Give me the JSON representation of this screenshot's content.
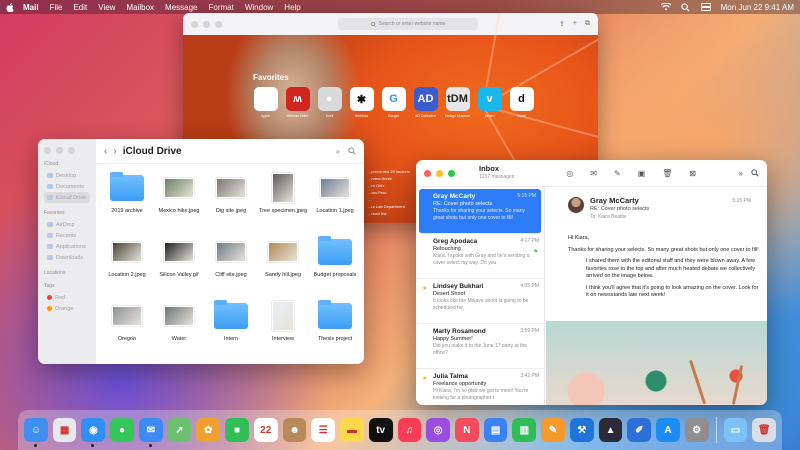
{
  "menubar": {
    "items": [
      "Mail",
      "File",
      "Edit",
      "View",
      "Mailbox",
      "Message",
      "Format",
      "Window",
      "Help"
    ],
    "clock": "Mon Jun 22  9:41 AM"
  },
  "safari": {
    "address_placeholder": "Search or enter website name",
    "favorites_title": "Favorites",
    "favorites": [
      {
        "label": "Apple",
        "glyph": "",
        "bg": "#ffffff",
        "fg": "#111111"
      },
      {
        "label": "Herman Miller",
        "glyph": "ʍ",
        "bg": "#d0261f",
        "fg": "#ffffff"
      },
      {
        "label": "Kvell",
        "glyph": "●",
        "bg": "#d9d9d9",
        "fg": "#ffffff"
      },
      {
        "label": "Webflow",
        "glyph": "✱",
        "bg": "#ffffff",
        "fg": "#111111"
      },
      {
        "label": "Google",
        "glyph": "G",
        "bg": "#ffffff",
        "fg": "#4285f4"
      },
      {
        "label": "AD Collective",
        "glyph": "AD",
        "bg": "#3b5ccf",
        "fg": "#ffffff"
      },
      {
        "label": "Design Museum",
        "glyph": "tDM",
        "bg": "#e6e6e6",
        "fg": "#222222"
      },
      {
        "label": "Vimeo",
        "glyph": "v",
        "bg": "#1ab7ea",
        "fg": "#ffffff"
      },
      {
        "label": "Dwell",
        "glyph": "d",
        "bg": "#ffffff",
        "fg": "#111111"
      }
    ],
    "snippets": [
      "...prevented 29 trackers",
      "...rview Annie",
      "...ro Ortiz",
      "...tan Peru",
      "...",
      "...ur Lab Department",
      "...nced the"
    ]
  },
  "finder": {
    "title": "iCloud Drive",
    "sidebar": {
      "icloud_header": "iCloud",
      "icloud_items": [
        "Desktop",
        "Documents",
        "iCloud Drive"
      ],
      "favorites_header": "Favorites",
      "favorites_items": [
        "AirDrop",
        "Recents",
        "Applications",
        "Downloads"
      ],
      "locations_header": "Locations",
      "tags_header": "Tags",
      "tags": [
        {
          "label": "Red",
          "color": "#ff3b30"
        },
        {
          "label": "Orange",
          "color": "#ff9500"
        }
      ]
    },
    "files": [
      {
        "name": "2019 archive",
        "kind": "folder"
      },
      {
        "name": "Mexico hike.jpeg",
        "kind": "photo",
        "tone": "#6d7f63"
      },
      {
        "name": "Dig site.jpeg",
        "kind": "photo",
        "tone": "#7a7670"
      },
      {
        "name": "Tree specimen.jpeg",
        "kind": "tall",
        "tone": "#5c5c5c"
      },
      {
        "name": "Location 1.jpeg",
        "kind": "photo",
        "tone": "#6b7f95"
      },
      {
        "name": "Location 2.jpeg",
        "kind": "photo",
        "tone": "#4b4438"
      },
      {
        "name": "Silicon Valley.gif",
        "kind": "photo",
        "tone": "#222222"
      },
      {
        "name": "Cliff site.jpeg",
        "kind": "photo",
        "tone": "#6f7b83"
      },
      {
        "name": "Sandy hill.jpeg",
        "kind": "photo",
        "tone": "#b28a55"
      },
      {
        "name": "Budget proposals",
        "kind": "folder"
      },
      {
        "name": "Oregon",
        "kind": "photo",
        "tone": "#8d9196"
      },
      {
        "name": "Water",
        "kind": "photo",
        "tone": "#6a7473"
      },
      {
        "name": "Intern",
        "kind": "folder"
      },
      {
        "name": "Interview",
        "kind": "tall",
        "tone": "#e9eef4"
      },
      {
        "name": "Thesis project",
        "kind": "folder"
      }
    ]
  },
  "mail": {
    "mailbox": "Inbox",
    "count": "1237 messages",
    "messages": [
      {
        "from": "Gray McCarty",
        "time": "5:15 PM",
        "subject": "RE: Cover photo selects",
        "preview": "Thanks for sharing your selects. So many great shots but only one cover to fill!",
        "selected": true,
        "star": false,
        "flag": false
      },
      {
        "from": "Greg Apodaca",
        "time": "4:17 PM",
        "subject": "Retouching",
        "preview": "Kiara, I spoke with Gray and he's sending a cover select my way. Do you",
        "selected": false,
        "star": false,
        "flag": true
      },
      {
        "from": "Lindsey Bukhari",
        "time": "4:05 PM",
        "subject": "Desert Shoot",
        "preview": "It looks like the Mojave shoot is going to be scheduled for",
        "selected": false,
        "star": true,
        "flag": false
      },
      {
        "from": "Marty Rosamond",
        "time": "3:59 PM",
        "subject": "Happy Summer!",
        "preview": "Did you make it to the June 17 party at the office?",
        "selected": false,
        "star": false,
        "flag": false
      },
      {
        "from": "Julia Talma",
        "time": "3:42 PM",
        "subject": "Freelance opportunity",
        "preview": "Hi Kiara, I'm so glad we got to meet! You're looking for a photographer t",
        "selected": false,
        "star": true,
        "flag": false
      }
    ],
    "reader": {
      "from": "Gray McCarty",
      "subject": "RE: Cover photo selects",
      "to_label": "To:",
      "to": "Kiara Beattie",
      "time": "5:15 PM",
      "greeting": "Hi Kiara,",
      "para1": "Thanks for sharing your selects. So many great shots but only one cover to fill!",
      "para2": "I shared them with the editorial staff and they were blown away. A few favorites rose to the top and after much heated debate we collectively arrived on the image below.",
      "para3": "I think you'll agree that it's going to look amazing on the cover. Look for it on newsstands late next week!"
    }
  },
  "dock": {
    "apps": [
      {
        "name": "Finder",
        "glyph": "☺",
        "bg": "#3f8ef0",
        "running": true
      },
      {
        "name": "Launchpad",
        "glyph": "▦",
        "bg": "#e8e8ee",
        "running": false
      },
      {
        "name": "Safari",
        "glyph": "◉",
        "bg": "#2f8ff3",
        "running": true
      },
      {
        "name": "Messages",
        "glyph": "●",
        "bg": "#35c659",
        "running": false
      },
      {
        "name": "Mail",
        "glyph": "✉",
        "bg": "#3d8bf2",
        "running": true
      },
      {
        "name": "Maps",
        "glyph": "➚",
        "bg": "#6cc070",
        "running": false
      },
      {
        "name": "Photos",
        "glyph": "✿",
        "bg": "#f0a030",
        "running": false
      },
      {
        "name": "FaceTime",
        "glyph": "■",
        "bg": "#2fbf54",
        "running": false
      },
      {
        "name": "Calendar",
        "glyph": "22",
        "bg": "#ffffff",
        "running": false
      },
      {
        "name": "Contacts",
        "glyph": "☻",
        "bg": "#b78a5a",
        "running": false
      },
      {
        "name": "Reminders",
        "glyph": "☰",
        "bg": "#ffffff",
        "running": false
      },
      {
        "name": "Notes",
        "glyph": "▬",
        "bg": "#fcd94a",
        "running": false
      },
      {
        "name": "TV",
        "glyph": "tv",
        "bg": "#111111",
        "running": false
      },
      {
        "name": "Music",
        "glyph": "♫",
        "bg": "#fb3c57",
        "running": false
      },
      {
        "name": "Podcasts",
        "glyph": "◎",
        "bg": "#9a4ee0",
        "running": false
      },
      {
        "name": "News",
        "glyph": "N",
        "bg": "#f44b5e",
        "running": false
      },
      {
        "name": "Keynote",
        "glyph": "▤",
        "bg": "#3b83f5",
        "running": false
      },
      {
        "name": "Numbers",
        "glyph": "▥",
        "bg": "#2fbd58",
        "running": false
      },
      {
        "name": "Pages",
        "glyph": "✎",
        "bg": "#f39a2b",
        "running": false
      },
      {
        "name": "Xcode",
        "glyph": "⚒",
        "bg": "#1e74d8",
        "running": false
      },
      {
        "name": "Instruments",
        "glyph": "▲",
        "bg": "#2a2a38",
        "running": false
      },
      {
        "name": "Sketch",
        "glyph": "✐",
        "bg": "#2c6fd9",
        "running": false
      },
      {
        "name": "App Store",
        "glyph": "A",
        "bg": "#1a8cf5",
        "running": false
      },
      {
        "name": "System Preferences",
        "glyph": "⚙",
        "bg": "#8e8e93",
        "running": false
      }
    ],
    "trailing": [
      {
        "name": "Downloads",
        "glyph": "▭",
        "bg": "#7cc2f7"
      },
      {
        "name": "Trash",
        "glyph": "🗑",
        "bg": "#d8dde6"
      }
    ]
  }
}
